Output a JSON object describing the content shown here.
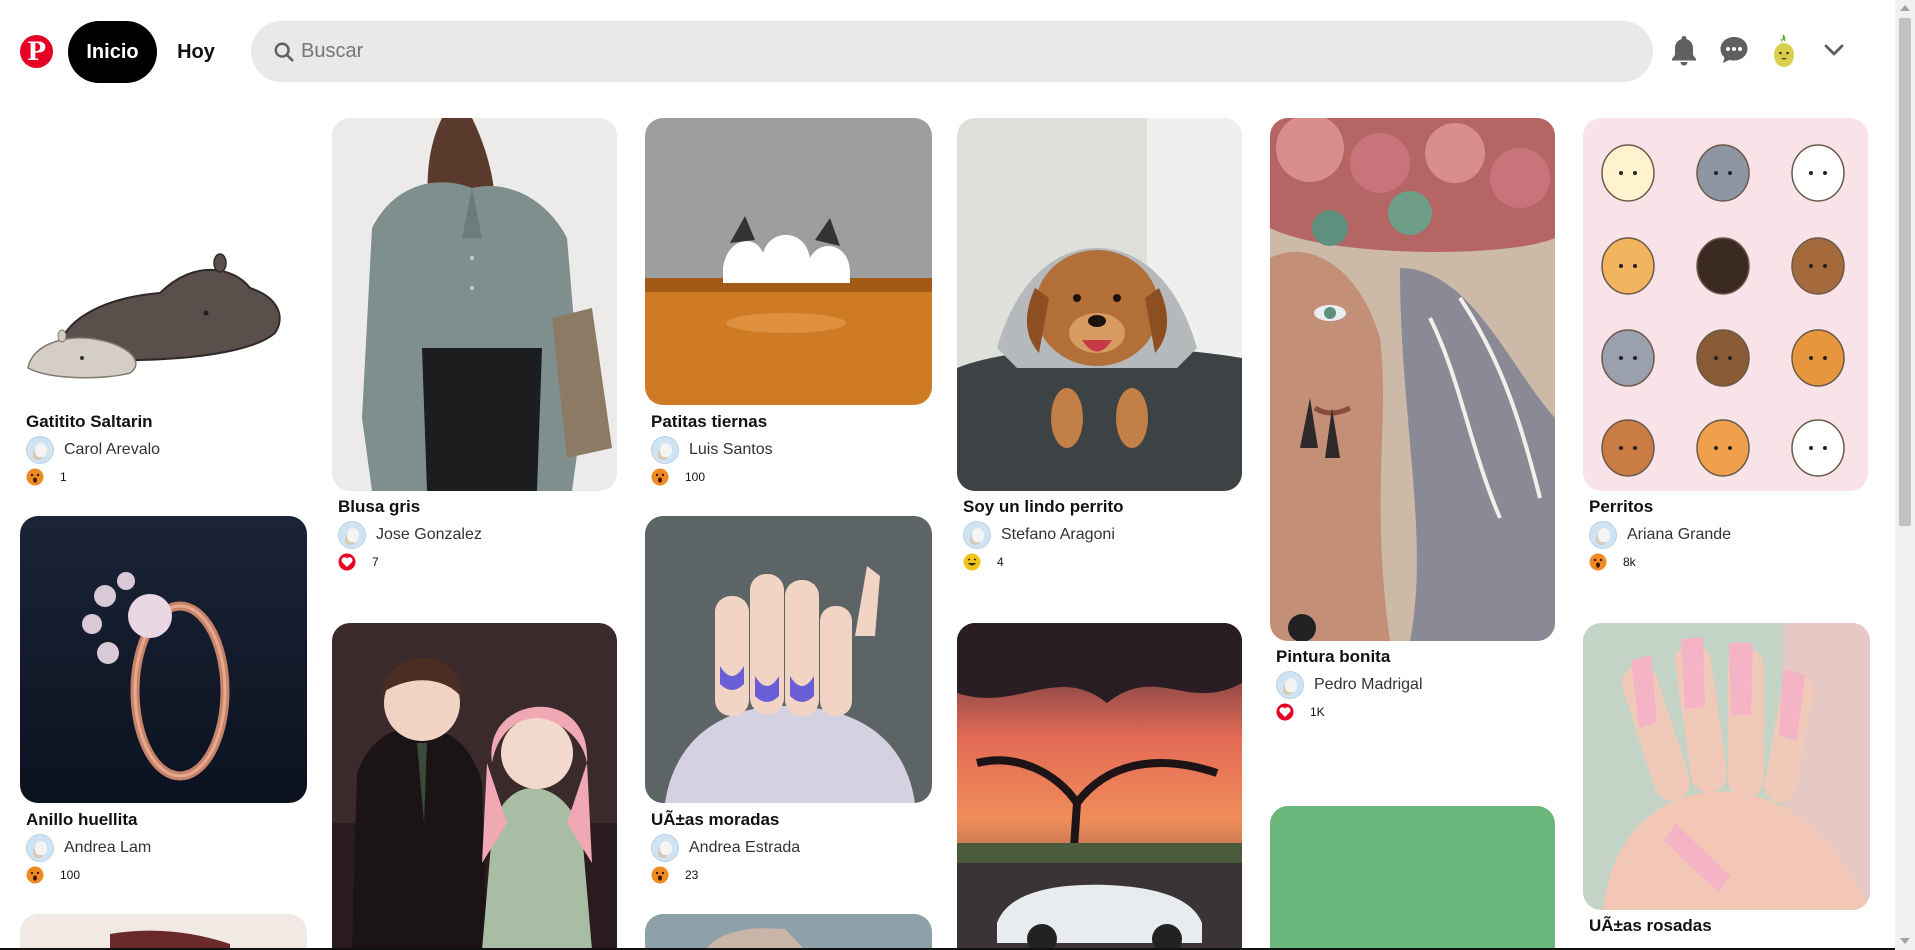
{
  "header": {
    "logo_letter": "P",
    "nav": {
      "inicio": "Inicio",
      "hoy": "Hoy"
    },
    "search": {
      "placeholder": "Buscar",
      "value": ""
    },
    "icons": [
      "bell-icon",
      "chat-icon",
      "profile-avatar",
      "chevron-down-icon"
    ]
  },
  "colors": {
    "brand": "#e60023",
    "nav_active_bg": "#000000",
    "search_bg": "#e9e9e9",
    "reaction_wow": "#f08a24",
    "reaction_love": "#e60023"
  },
  "pins": [
    {
      "title": "Gatitito Saltarin",
      "user": "Carol Arevalo",
      "reaction": "wow",
      "count": "1"
    },
    {
      "title": "Blusa gris",
      "user": "Jose Gonzalez",
      "reaction": "love",
      "count": "7"
    },
    {
      "title": "Patitas tiernas",
      "user": "Luis Santos",
      "reaction": "wow",
      "count": "100"
    },
    {
      "title": "Soy un lindo perrito",
      "user": "Stefano Aragoni",
      "reaction": "haha",
      "count": "4"
    },
    {
      "title": "Pintura bonita",
      "user": "Pedro Madrigal",
      "reaction": "love",
      "count": "1K"
    },
    {
      "title": "Perritos",
      "user": "Ariana Grande",
      "reaction": "wow",
      "count": "8k"
    },
    {
      "title": "Anillo huellita",
      "user": "Andrea Lam",
      "reaction": "wow",
      "count": "100"
    },
    {
      "title": "UÃ±as moradas",
      "user": "Andrea Estrada",
      "reaction": "wow",
      "count": "23"
    },
    {
      "title": "UÃ±as rosadas"
    }
  ]
}
